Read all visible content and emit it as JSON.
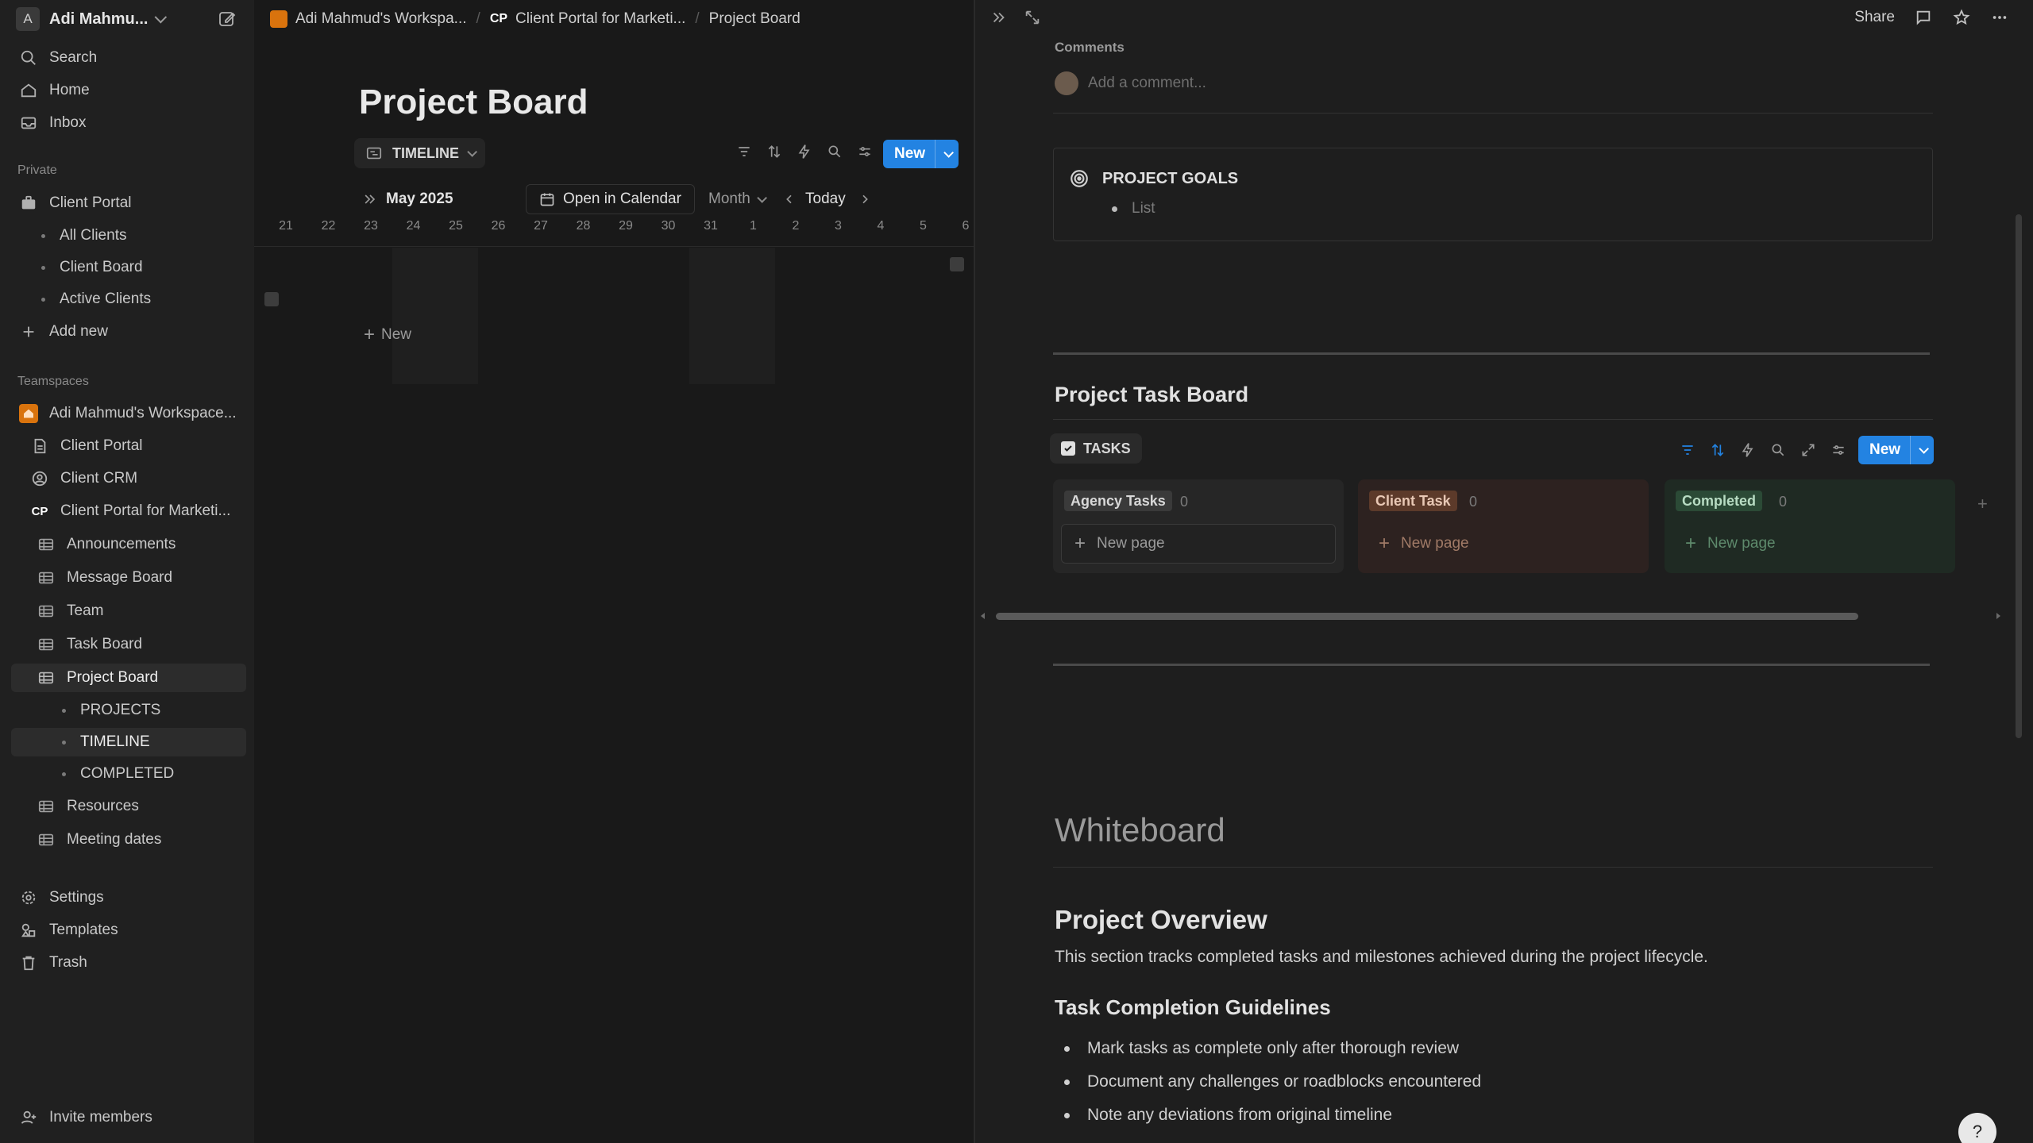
{
  "workspace": {
    "avatar_letter": "A",
    "name": "Adi Mahmu..."
  },
  "sidebar": {
    "top": [
      {
        "label": "Search",
        "icon": "search-icon"
      },
      {
        "label": "Home",
        "icon": "home-icon"
      },
      {
        "label": "Inbox",
        "icon": "inbox-icon"
      }
    ],
    "private_label": "Private",
    "private": {
      "root": "Client Portal",
      "children": [
        "All Clients",
        "Client Board",
        "Active Clients"
      ],
      "add_new": "Add new"
    },
    "teamspaces_label": "Teamspaces",
    "teamspace": {
      "name": "Adi Mahmud's Workspace...",
      "items": [
        "Client Portal",
        "Client CRM"
      ],
      "cp_badge": "CP",
      "cp_name": "Client Portal for Marketi...",
      "db_items": [
        "Announcements",
        "Message Board",
        "Team",
        "Task Board",
        "Project Board"
      ],
      "project_views": [
        "PROJECTS",
        "TIMELINE",
        "COMPLETED"
      ],
      "db_items_after": [
        "Resources",
        "Meeting dates"
      ]
    },
    "bottom": [
      {
        "label": "Settings",
        "icon": "gear-icon"
      },
      {
        "label": "Templates",
        "icon": "templates-icon"
      },
      {
        "label": "Trash",
        "icon": "trash-icon"
      }
    ],
    "invite": "Invite members"
  },
  "breadcrumb": {
    "ws": "Adi Mahmud's Workspa...",
    "cp_badge": "CP",
    "portal": "Client Portal for Marketi...",
    "current": "Project Board"
  },
  "main": {
    "title": "Project Board",
    "view_tab": "TIMELINE",
    "new_label": "New",
    "month": "May 2025",
    "open_calendar": "Open in Calendar",
    "scale": "Month",
    "today": "Today",
    "days": [
      "21",
      "22",
      "23",
      "24",
      "25",
      "26",
      "27",
      "28",
      "29",
      "30",
      "31",
      "1",
      "2",
      "3",
      "4",
      "5",
      "6"
    ],
    "new_row": "New"
  },
  "peek": {
    "share": "Share",
    "comments_label": "Comments",
    "comment_placeholder": "Add a comment...",
    "goals_title": "PROJECT GOALS",
    "goals_item": "List",
    "task_board_title": "Project Task Board",
    "tasks_tab": "TASKS",
    "new_label": "New",
    "columns": [
      {
        "name": "Agency Tasks",
        "count": "0",
        "new": "New page"
      },
      {
        "name": "Client Task",
        "count": "0",
        "new": "New page"
      },
      {
        "name": "Completed",
        "count": "0",
        "new": "New page"
      }
    ],
    "whiteboard": "Whiteboard",
    "overview_title": "Project Overview",
    "overview_desc": "This section tracks completed tasks and milestones achieved during the project lifecycle.",
    "guidelines_title": "Task Completion Guidelines",
    "guidelines": [
      "Mark tasks as complete only after thorough review",
      "Document any challenges or roadblocks encountered",
      "Note any deviations from original timeline"
    ]
  },
  "colors": {
    "accent": "#2383e2",
    "agency_tag": "#3a3a3a",
    "client_tag": "#5c3a2a",
    "completed_tag": "#2b4a36"
  }
}
